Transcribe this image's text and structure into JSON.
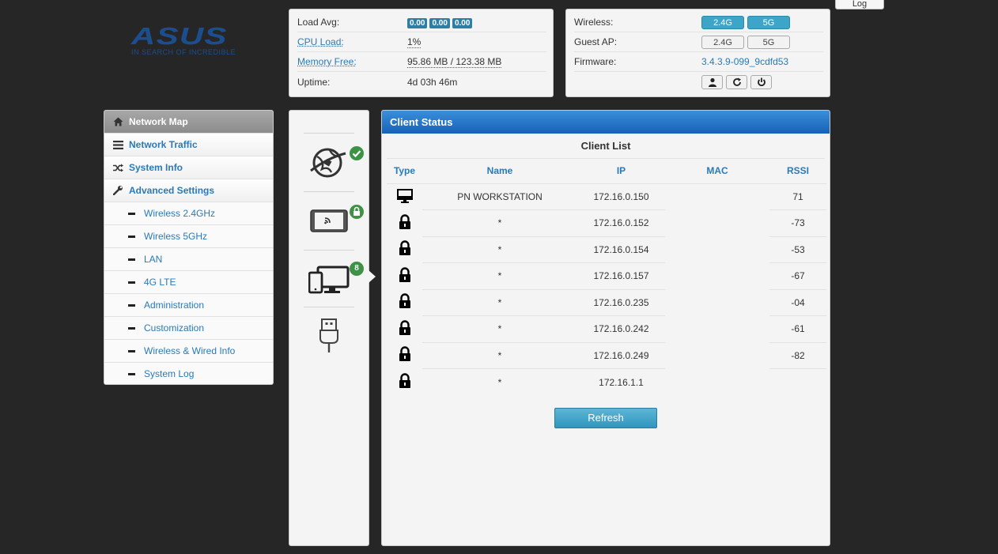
{
  "header": {
    "log_label": "Log",
    "logo": {
      "word": "ASUS",
      "tagline": "IN SEARCH OF INCREDIBLE",
      "color": "#1c4e8f"
    }
  },
  "system": {
    "load_avg": {
      "label": "Load Avg:",
      "values": [
        "0.00",
        "0.00",
        "0.00"
      ]
    },
    "cpu": {
      "label": "CPU Load:",
      "value": "1%"
    },
    "memory": {
      "label": "Memory Free:",
      "value": "95.86 MB / 123.38 MB"
    },
    "uptime": {
      "label": "Uptime:",
      "value": "4d 03h 46m"
    }
  },
  "wireless": {
    "wireless": {
      "label": "Wireless:",
      "b24": "2.4G",
      "b5": "5G"
    },
    "guest": {
      "label": "Guest AP:",
      "b24": "2.4G",
      "b5": "5G"
    },
    "firmware": {
      "label": "Firmware:",
      "value": "3.4.3.9-099_9cdfd53"
    },
    "icons": [
      "user-icon",
      "restart-icon",
      "power-icon"
    ]
  },
  "menu": {
    "items": [
      {
        "label": "Network Map",
        "icon": "home-icon"
      },
      {
        "label": "Network Traffic",
        "icon": "traffic-icon"
      },
      {
        "label": "System Info",
        "icon": "shuffle-icon"
      },
      {
        "label": "Advanced Settings",
        "icon": "wrench-icon"
      }
    ],
    "sub": [
      "Wireless 2.4GHz",
      "Wireless 5GHz",
      "LAN",
      "4G LTE",
      "Administration",
      "Customization",
      "Wireless & Wired Info",
      "System Log"
    ]
  },
  "map": {
    "client_count": "8",
    "accent": "#3d9245"
  },
  "client": {
    "header": "Client Status",
    "title": "Client List",
    "columns": [
      "Type",
      "Name",
      "IP",
      "MAC",
      "RSSI"
    ],
    "rows": [
      {
        "type": "desktop-icon",
        "name": "PN WORKSTATION",
        "ip": "172.16.0.150",
        "mac": "",
        "rssi": "71"
      },
      {
        "type": "lock-icon",
        "name": "*",
        "ip": "172.16.0.152",
        "mac": "",
        "rssi": "-73"
      },
      {
        "type": "lock-icon",
        "name": "*",
        "ip": "172.16.0.154",
        "mac": "",
        "rssi": "-53"
      },
      {
        "type": "lock-icon",
        "name": "*",
        "ip": "172.16.0.157",
        "mac": "",
        "rssi": "-67"
      },
      {
        "type": "lock-icon",
        "name": "*",
        "ip": "172.16.0.235",
        "mac": "",
        "rssi": "-04"
      },
      {
        "type": "lock-icon",
        "name": "*",
        "ip": "172.16.0.242",
        "mac": "",
        "rssi": "-61"
      },
      {
        "type": "lock-icon",
        "name": "*",
        "ip": "172.16.0.249",
        "mac": "",
        "rssi": "-82"
      },
      {
        "type": "lock-icon",
        "name": "*",
        "ip": "172.16.1.1",
        "mac": "",
        "rssi": ""
      }
    ],
    "refresh_label": "Refresh",
    "header_color": "#1661b8",
    "link_color": "#2a7ab8"
  }
}
